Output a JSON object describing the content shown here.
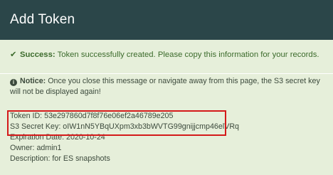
{
  "dialog": {
    "title": "Add Token"
  },
  "success": {
    "icon": "check-icon",
    "label": "Success:",
    "message": "Token successfully created. Please copy this information for your records.",
    "color": "#3c6b2c"
  },
  "notice": {
    "icon": "info-circle-icon",
    "label": "Notice:",
    "message": "Once you close this message or navigate away from this page, the S3 secret key will not be displayed again!"
  },
  "token": {
    "id_label": "Token ID:",
    "id_value": "53e297860d7f8f76e06ef2a46789e205",
    "secret_label": "S3 Secret Key:",
    "secret_value": "oIW1nN5YBqUXpm3xb3bWVTG99gnijjcmp46elVRq",
    "expiration_label": "Expiration Date:",
    "expiration_value": "2020-10-24",
    "owner_label": "Owner:",
    "owner_value": "admin1",
    "description_label": "Description:",
    "description_value": "for ES snapshots"
  },
  "colors": {
    "header_bg": "#2b4649",
    "body_bg": "#e6efda",
    "highlight_border": "#d41a1a"
  }
}
